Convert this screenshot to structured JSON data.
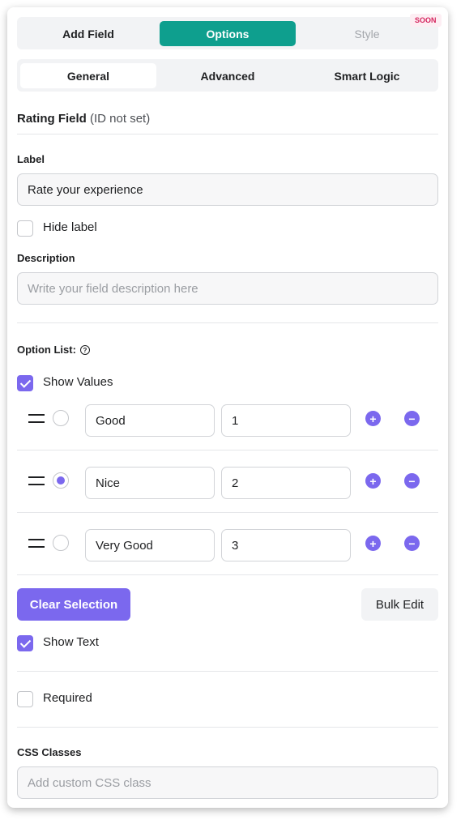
{
  "top_tabs": {
    "add_field": "Add Field",
    "options": "Options",
    "style": "Style",
    "soon_badge": "SOON"
  },
  "sub_tabs": {
    "general": "General",
    "advanced": "Advanced",
    "smart_logic": "Smart Logic"
  },
  "header": {
    "field_type": "Rating Field",
    "id_note": "(ID not set)"
  },
  "label_field": {
    "label": "Label",
    "value": "Rate your experience"
  },
  "hide_label": {
    "label": "Hide label",
    "checked": false
  },
  "description_field": {
    "label": "Description",
    "placeholder": "Write your field description here"
  },
  "option_list": {
    "label": "Option List:",
    "help_icon": "question-circle-icon",
    "show_values_label": "Show Values",
    "show_values_checked": true,
    "options": [
      {
        "label": "Good",
        "value": "1",
        "selected": false
      },
      {
        "label": "Nice",
        "value": "2",
        "selected": true
      },
      {
        "label": "Very Good",
        "value": "3",
        "selected": false
      }
    ],
    "add_symbol": "+",
    "remove_symbol": "−"
  },
  "actions": {
    "clear_selection": "Clear Selection",
    "bulk_edit": "Bulk Edit"
  },
  "show_text": {
    "label": "Show Text",
    "checked": true
  },
  "required": {
    "label": "Required",
    "checked": false
  },
  "css_classes": {
    "label": "CSS Classes",
    "placeholder": "Add custom CSS class"
  },
  "colors": {
    "accent_teal": "#0e9f8e",
    "accent_purple": "#7b68ee",
    "soon_badge": "#d5255e"
  }
}
